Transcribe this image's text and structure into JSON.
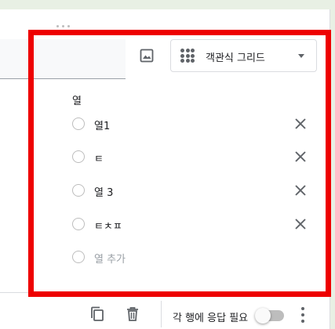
{
  "question_type": {
    "selected": "객관식 그리드",
    "icon": "grid-dots-icon"
  },
  "image_button": {
    "icon": "image-icon"
  },
  "columns": {
    "section_label": "열",
    "items": [
      {
        "label": "열1"
      },
      {
        "label": "ㅌ"
      },
      {
        "label": "열 3"
      },
      {
        "label": "ㅌㅊㅍ"
      }
    ],
    "add_label": "열 추가",
    "remove_icon": "close-icon"
  },
  "footer": {
    "copy_icon": "copy-icon",
    "delete_icon": "trash-icon",
    "required_label": "각 행에 응답 필요",
    "required_on": false,
    "more_icon": "more-vert-icon"
  },
  "highlight_color": "#ee0000"
}
